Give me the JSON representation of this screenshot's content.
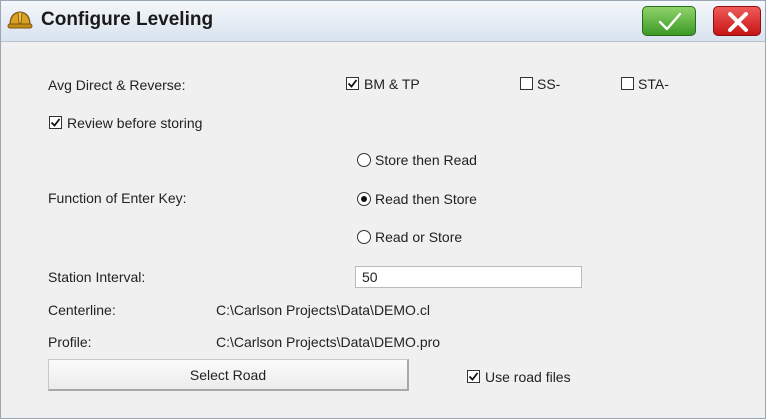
{
  "window": {
    "title": "Configure Leveling"
  },
  "colors": {
    "ok_green": "#3c9a25",
    "close_red": "#c81414",
    "titlebar": "#d9e3ee"
  },
  "avg": {
    "label": "Avg Direct & Reverse:",
    "options": [
      {
        "label": "BM & TP",
        "checked": true
      },
      {
        "label": "SS-",
        "checked": false
      },
      {
        "label": "STA-",
        "checked": false
      }
    ]
  },
  "review": {
    "label": "Review before storing",
    "checked": true
  },
  "enter_key": {
    "label": "Function of Enter Key:",
    "options": [
      {
        "label": "Store then Read",
        "selected": false
      },
      {
        "label": "Read then Store",
        "selected": true
      },
      {
        "label": "Read or Store",
        "selected": false
      }
    ]
  },
  "station_interval": {
    "label": "Station Interval:",
    "value": "50"
  },
  "centerline": {
    "label": "Centerline:",
    "value": "C:\\Carlson Projects\\Data\\DEMO.cl"
  },
  "profile": {
    "label": "Profile:",
    "value": "C:\\Carlson Projects\\Data\\DEMO.pro"
  },
  "select_road": {
    "label": "Select Road"
  },
  "use_road_files": {
    "label": "Use road files",
    "checked": true
  },
  "icons": {
    "title": "hard-hat-icon",
    "ok": "checkmark-icon",
    "close": "x-icon"
  }
}
